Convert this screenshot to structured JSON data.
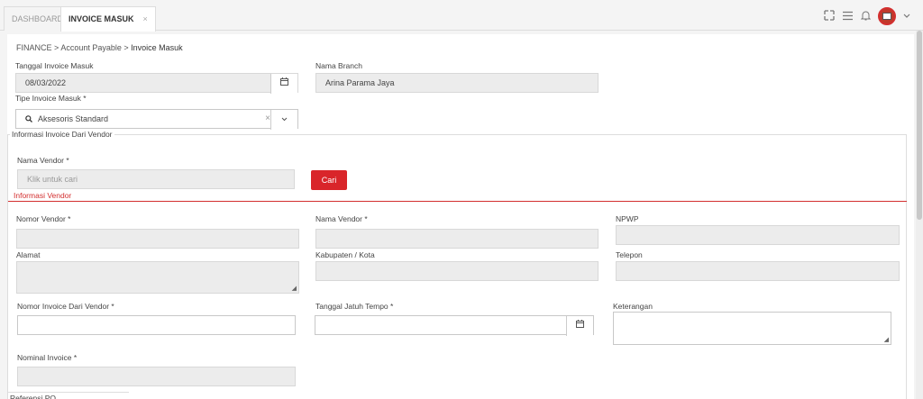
{
  "tabs": [
    {
      "label": "DASHBOARD"
    },
    {
      "label": "INVOICE MASUK",
      "close": "×"
    }
  ],
  "icons": {
    "expand": "⤧",
    "menu": "≡",
    "bell": "🔔",
    "chevron": "⌄"
  },
  "breadcrumb": {
    "l1": "FINANCE",
    "sep": ">",
    "l2": "Account Payable",
    "l3": "Invoice Masuk"
  },
  "form": {
    "tanggal_label": "Tanggal Invoice Masuk",
    "tanggal_value": "08/03/2022",
    "branch_label": "Nama Branch",
    "branch_value": "Arina Parama Jaya",
    "tipe_label": "Tipe Invoice Masuk *",
    "tipe_value": "Aksesoris Standard",
    "tipe_clear": "×"
  },
  "vendor_section": {
    "legend": "Informasi Invoice Dari Vendor",
    "nama_vendor_label": "Nama Vendor *",
    "nama_vendor_placeholder": "Klik untuk cari",
    "cari_button": "Cari",
    "info_vendor_title": "Informasi Vendor",
    "nomor_vendor_label": "Nomor Vendor *",
    "nama_vendor2_label": "Nama Vendor *",
    "npwp_label": "NPWP",
    "alamat_label": "Alamat",
    "kabupaten_label": "Kabupaten / Kota",
    "telepon_label": "Telepon",
    "nomor_invoice_label": "Nomor Invoice Dari Vendor *",
    "jatuh_tempo_label": "Tanggal Jatuh Tempo *",
    "keterangan_label": "Keterangan",
    "nominal_label": "Nominal Invoice *",
    "bottom_legend": "Referensi PO"
  }
}
